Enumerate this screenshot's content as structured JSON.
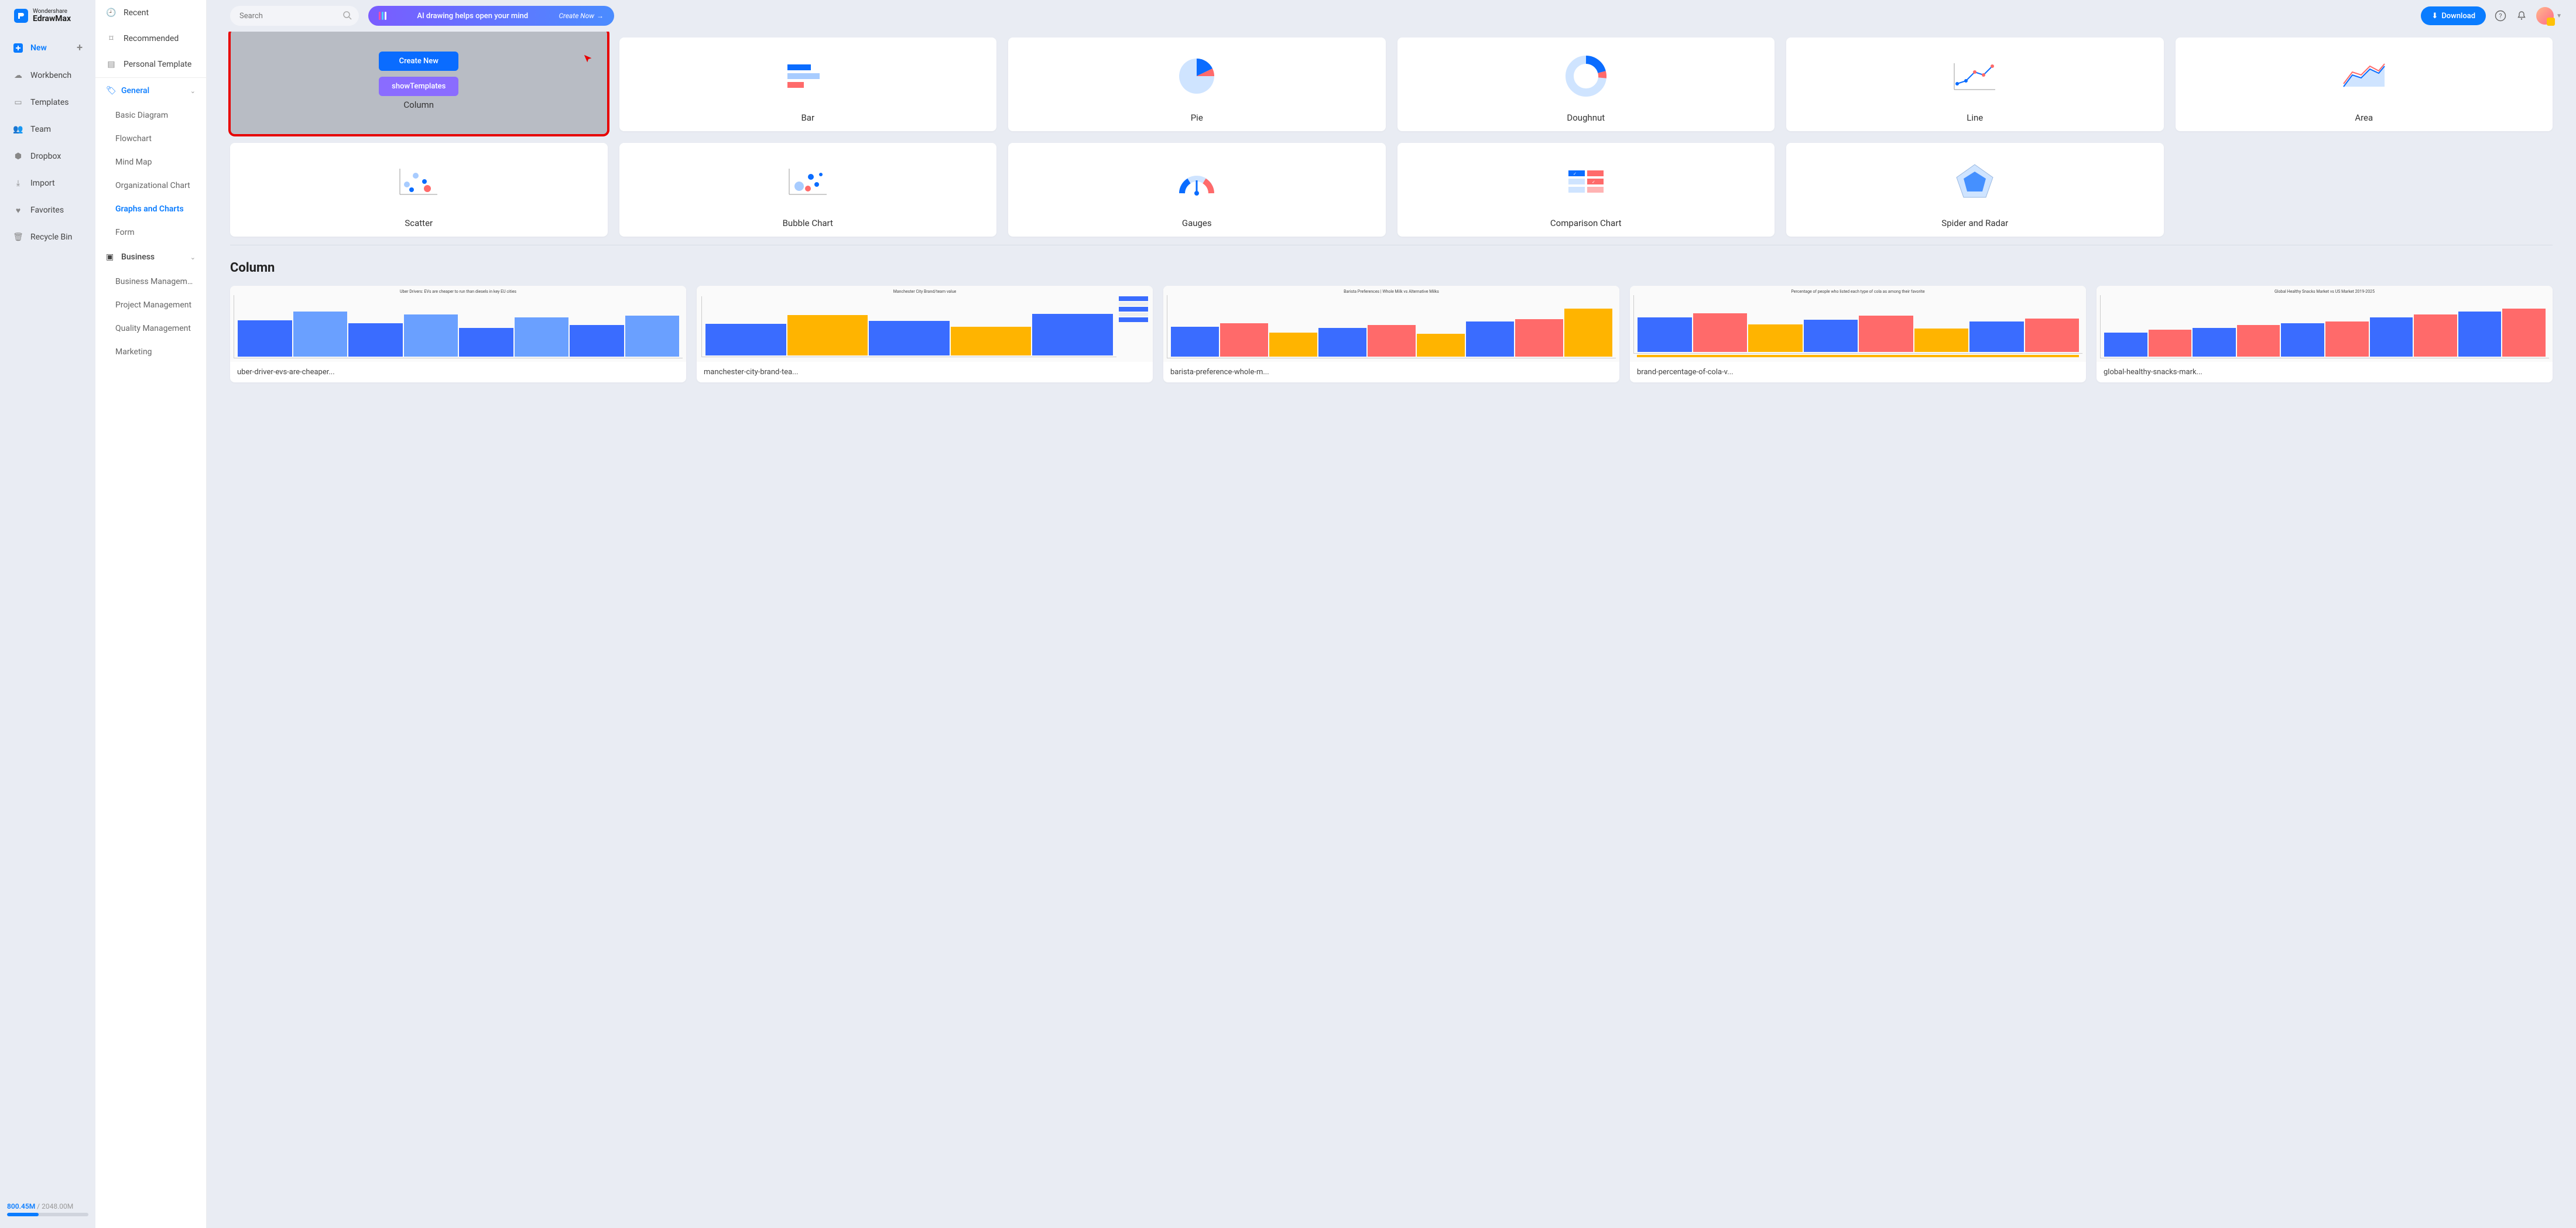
{
  "logo": {
    "company": "Wondershare",
    "product": "EdrawMax"
  },
  "nav": {
    "new": "New",
    "workbench": "Workbench",
    "templates": "Templates",
    "team": "Team",
    "dropbox": "Dropbox",
    "import": "Import",
    "favorites": "Favorites",
    "recycle": "Recycle Bin"
  },
  "storage": {
    "used": "800.45M",
    "total": "2048.00M"
  },
  "cat_top": {
    "recent": "Recent",
    "recommended": "Recommended",
    "personal": "Personal Template"
  },
  "groups": {
    "general": {
      "label": "General",
      "items": [
        "Basic Diagram",
        "Flowchart",
        "Mind Map",
        "Organizational Chart",
        "Graphs and Charts",
        "Form"
      ]
    },
    "business": {
      "label": "Business",
      "items": [
        "Business Management",
        "Project Management",
        "Quality Management",
        "Marketing"
      ]
    }
  },
  "search": {
    "placeholder": "Search"
  },
  "banner": {
    "text": "AI drawing helps open your mind",
    "cta": "Create Now"
  },
  "download": "Download",
  "hover": {
    "create": "Create New",
    "show": "showTemplates"
  },
  "tiles": [
    "Column",
    "Bar",
    "Pie",
    "Doughnut",
    "Line",
    "Area",
    "Scatter",
    "Bubble Chart",
    "Gauges",
    "Comparison Chart",
    "Spider and Radar"
  ],
  "section": {
    "column": "Column"
  },
  "templates": [
    "uber-driver-evs-are-cheaper...",
    "manchester-city-brand-tea...",
    "barista-preference-whole-m...",
    "brand-percentage-of-cola-v...",
    "global-healthy-snacks-mark..."
  ],
  "template_headers": [
    "Uber Drivers: EVs are cheaper to run than diesels in key EU cities",
    "Manchester City Brand/team value",
    "Barista Preferences | Whole Milk vs Alternative Milks",
    "Percentage of people who listed each type of cola as among their favorite",
    "Global Healthy Snacks Market vs US Market 2019-2025"
  ]
}
